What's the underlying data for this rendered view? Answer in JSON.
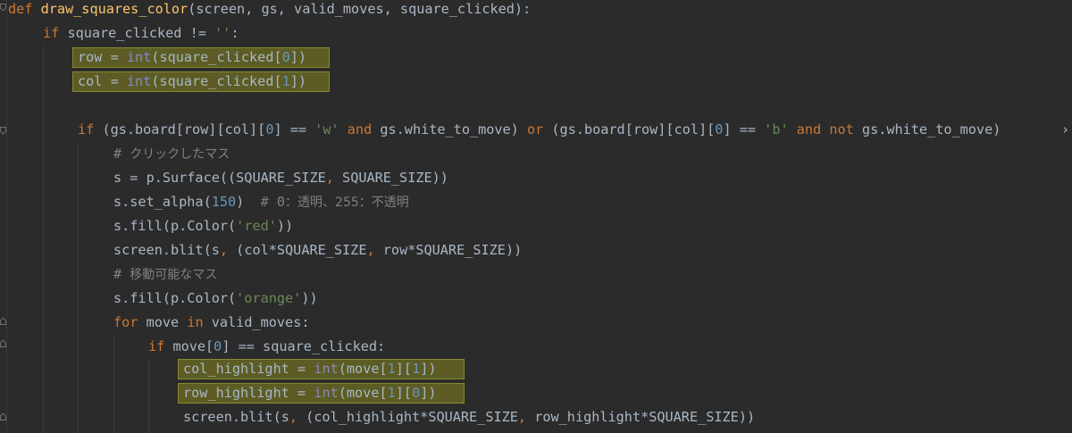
{
  "code": {
    "line1": {
      "kw": "def",
      "fn": "draw_squares_color",
      "rest": "(screen, gs, valid_moves, square_clicked):"
    },
    "line2": {
      "kw": "if",
      "a": " square_clicked != ",
      "str": "''",
      "b": ":"
    },
    "line3": {
      "a": "row = ",
      "bi": "int",
      "b": "(square_clicked[",
      "num": "0",
      "c": "])"
    },
    "line4": {
      "a": "col = ",
      "bi": "int",
      "b": "(square_clicked[",
      "num": "1",
      "c": "])"
    },
    "line6": {
      "kw1": "if",
      "a": " (gs.board[row][col][",
      "num1": "0",
      "b": "] == ",
      "str1": "'w'",
      "kw2": "and",
      "c": " gs.white_to_move) ",
      "kw3": "or",
      "d": " (gs.board[row][col][",
      "num2": "0",
      "e": "] == ",
      "str2": "'b'",
      "kw4": "and not",
      "f": " gs.white_to_move)",
      "more": "›"
    },
    "line7": {
      "hash": "# ",
      "jp": "クリックしたマス"
    },
    "line8": {
      "a": "s = p.Surface((SQUARE_SIZE",
      "comma": ",",
      "b": " SQUARE_SIZE))"
    },
    "line9": {
      "a": "s.set_alpha(",
      "num": "150",
      "b": ")  ",
      "cm1": "# 0",
      "jp": "：透明、255：不透明"
    },
    "line10": {
      "a": "s.fill(p.Color(",
      "str": "'red'",
      "b": "))"
    },
    "line11": {
      "a": "screen.blit(s",
      "comma": ",",
      "b": " (col*SQUARE_SIZE",
      "comma2": ",",
      "c": " row*SQUARE_SIZE))"
    },
    "line12": {
      "hash": "# ",
      "jp": "移動可能なマス"
    },
    "line13": {
      "a": "s.fill(p.Color(",
      "str": "'orange'",
      "b": "))"
    },
    "line14": {
      "kw1": "for",
      "a": " move ",
      "kw2": "in",
      "b": " valid_moves:"
    },
    "line15": {
      "kw": "if",
      "a": " move[",
      "num": "0",
      "b": "] == square_clicked:"
    },
    "line16": {
      "a": "col_highlight = ",
      "bi": "int",
      "b": "(move[",
      "num1": "1",
      "c": "][",
      "num2": "1",
      "d": "])"
    },
    "line17": {
      "a": "row_highlight = ",
      "bi": "int",
      "b": "(move[",
      "num1": "1",
      "c": "][",
      "num2": "0",
      "d": "])"
    },
    "line18": {
      "a": "screen.blit(s",
      "comma": ",",
      "b": " (col_highlight*SQUARE_SIZE",
      "comma2": ",",
      "c": " row_highlight*SQUARE_SIZE))"
    }
  },
  "colors": {
    "background": "#2b2b2b",
    "keyword": "#cc7832",
    "function": "#ffc66d",
    "builtin": "#8888c6",
    "number": "#6897bb",
    "string": "#6a8759",
    "comment": "#808080",
    "text": "#a9b7c6",
    "highlight": "#5c5c24"
  }
}
